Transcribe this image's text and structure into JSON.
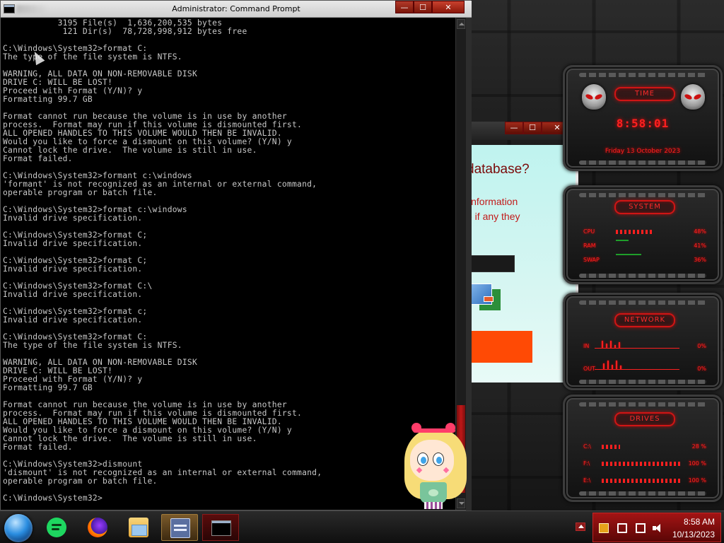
{
  "cmd_window": {
    "title": "Administrator: Command Prompt",
    "buttons": {
      "minimize": "—",
      "maximize": "☐",
      "close": "✕"
    },
    "lines": [
      "           3195 File(s)  1,636,200,535 bytes",
      "            121 Dir(s)  78,728,998,912 bytes free",
      "",
      "C:\\Windows\\System32>format C:",
      "The type of the file system is NTFS.",
      "",
      "WARNING, ALL DATA ON NON-REMOVABLE DISK",
      "DRIVE C: WILL BE LOST!",
      "Proceed with Format (Y/N)? y",
      "Formatting 99.7 GB",
      "",
      "Format cannot run because the volume is in use by another",
      "process.  Format may run if this volume is dismounted first.",
      "ALL OPENED HANDLES TO THIS VOLUME WOULD THEN BE INVALID.",
      "Would you like to force a dismount on this volume? (Y/N) y",
      "Cannot lock the drive.  The volume is still in use.",
      "Format failed.",
      "",
      "C:\\Windows\\System32>formant c:\\windows",
      "'formant' is not recognized as an internal or external command,",
      "operable program or batch file.",
      "",
      "C:\\Windows\\System32>format c:\\windows",
      "Invalid drive specification.",
      "",
      "C:\\Windows\\System32>format C;",
      "Invalid drive specification.",
      "",
      "C:\\Windows\\System32>format C;",
      "Invalid drive specification.",
      "",
      "C:\\Windows\\System32>format C:\\",
      "Invalid drive specification.",
      "",
      "C:\\Windows\\System32>format c;",
      "Invalid drive specification.",
      "",
      "C:\\Windows\\System32>format C:",
      "The type of the file system is NTFS.",
      "",
      "WARNING, ALL DATA ON NON-REMOVABLE DISK",
      "DRIVE C: WILL BE LOST!",
      "Proceed with Format (Y/N)? y",
      "Formatting 99.7 GB",
      "",
      "Format cannot run because the volume is in use by another",
      "process.  Format may run if this volume is dismounted first.",
      "ALL OPENED HANDLES TO THIS VOLUME WOULD THEN BE INVALID.",
      "Would you like to force a dismount on this volume? (Y/N) y",
      "Cannot lock the drive.  The volume is still in use.",
      "Format failed.",
      "",
      "C:\\Windows\\System32>dismount",
      "'dismount' is not recognized as an internal or external command,",
      "operable program or batch file.",
      "",
      "C:\\Windows\\System32>"
    ]
  },
  "background_window": {
    "heading": "database?",
    "line1": "information",
    "line2": "e if any they",
    "buttons": {
      "minimize": "—",
      "maximize": "☐",
      "close": "✕"
    }
  },
  "gadgets": {
    "time": {
      "header": "TIME",
      "clock": "8:58:01",
      "date": "Friday 13 October 2023"
    },
    "system": {
      "header": "SYSTEM",
      "rows": [
        {
          "label": "CPU",
          "value": "48%"
        },
        {
          "label": "RAM",
          "value": "41%"
        },
        {
          "label": "SWAP",
          "value": "36%"
        }
      ]
    },
    "network": {
      "header": "NETWORK",
      "rows": [
        {
          "label": "IN",
          "value": "0%"
        },
        {
          "label": "OUT",
          "value": "0%"
        }
      ]
    },
    "drives": {
      "header": "DRIVES",
      "rows": [
        {
          "label": "C:\\",
          "value": "28 %"
        },
        {
          "label": "F:\\",
          "value": "100 %"
        },
        {
          "label": "E:\\",
          "value": "100 %"
        }
      ]
    }
  },
  "taskbar": {
    "items": [
      "start-orb-icon",
      "spotify-icon",
      "firefox-icon",
      "file-explorer-icon",
      "screen-app-icon",
      "command-prompt-icon"
    ],
    "tray": {
      "time": "8:58 AM",
      "date": "10/13/2023"
    }
  }
}
